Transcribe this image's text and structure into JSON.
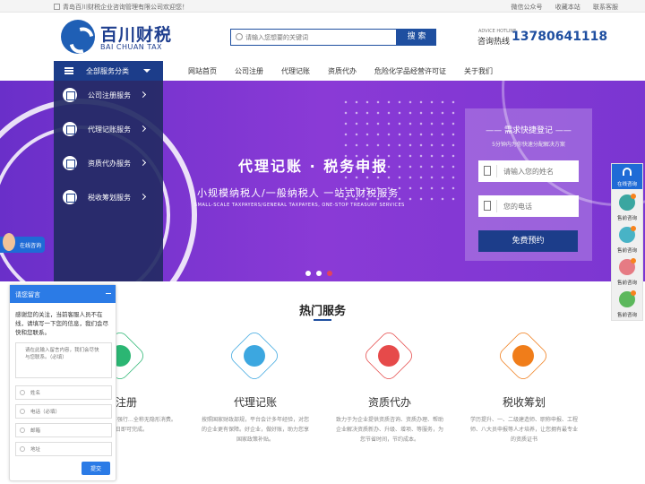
{
  "topbar": {
    "welcome": "青岛百川财税企业咨询管理有限公司欢迎您！",
    "wechat": "微信公众号",
    "bookmark": "收藏本站",
    "contact": "联系客服"
  },
  "header": {
    "logo_cn": "百川财税",
    "logo_en": "BAI CHUAN TAX",
    "search_placeholder": "请输入您想要的关键词",
    "search_button": "搜 索",
    "advice_label": "ADVICE HOTLINE",
    "hotline_label": "咨询热线",
    "hotline_number": "13780641118"
  },
  "nav": {
    "category_label": "全部服务分类",
    "items": [
      "网站首页",
      "公司注册",
      "代理记账",
      "资质代办",
      "危险化学品经营许可证",
      "关于我们"
    ]
  },
  "side_menu": {
    "items": [
      "公司注册服务",
      "代理记账服务",
      "资质代办服务",
      "税收筹划服务"
    ]
  },
  "banner": {
    "title": "代理记账 · 税务申报",
    "subtitle": "小规模纳税人/一般纳税人  一站式财税服务",
    "subtitle_en": "SMALL-SCALE TAXPAYERS/GENERAL TAXPAYERS, ONE-STOP TREASURY SERVICES",
    "active_slide": 3,
    "slide_count": 3
  },
  "quick_form": {
    "title": "—— 需求快捷登记 ——",
    "subtitle": "5分钟内为你快速分配解决方案",
    "name_placeholder": "请输入您的姓名",
    "phone_placeholder": "您的电话",
    "submit": "免费预约"
  },
  "hot": {
    "title": "热门服务",
    "services": [
      {
        "name": "司注册",
        "desc": "…办，0元服务费。不强行…全称无隐形消费。服…工作日即可完成。",
        "color": "#2bb673",
        "icon": "shield-check-icon"
      },
      {
        "name": "代理记账",
        "desc": "按照国家财政部规，平台会计多年经验，对您的企业更有保障。好企业，做好账，助力您享国家政策补贴。",
        "color": "#3ca7e0",
        "icon": "coupon-icon"
      },
      {
        "name": "资质代办",
        "desc": "致力于为企业提供资质咨询、资质办理、帮助企业解决资质新办、升级、增项、等服务，为您节省时间，节约成本。",
        "color": "#e64a4a",
        "icon": "medal-icon"
      },
      {
        "name": "税收筹划",
        "desc": "学历提升、一、二级建造师、职称申报、工程师、八大员申报等人才培养，让您拥有最专业的资质证书",
        "color": "#f07d1a",
        "icon": "rocket-icon"
      }
    ]
  },
  "chat": {
    "mini_label": "在线咨询",
    "header": "请您留言",
    "message": "感谢您的关注，当前客服人员不在线，请填写一下您的信息，我们会尽快和您联系。",
    "textarea_placeholder": "请在此输入留言内容，我们会尽快与您联系。（必填）",
    "name_placeholder": "姓名",
    "phone_placeholder": "电话（必填）",
    "email_placeholder": "邮箱",
    "address_placeholder": "地址",
    "submit": "提交"
  },
  "right_bar": {
    "top_label": "在线咨询",
    "items": [
      {
        "label": "售前咨询",
        "color": "#3aa6a0"
      },
      {
        "label": "售前咨询",
        "color": "#48b3c6"
      },
      {
        "label": "售前咨询",
        "color": "#e67b84"
      },
      {
        "label": "售前咨询",
        "color": "#5cb85c"
      }
    ]
  }
}
